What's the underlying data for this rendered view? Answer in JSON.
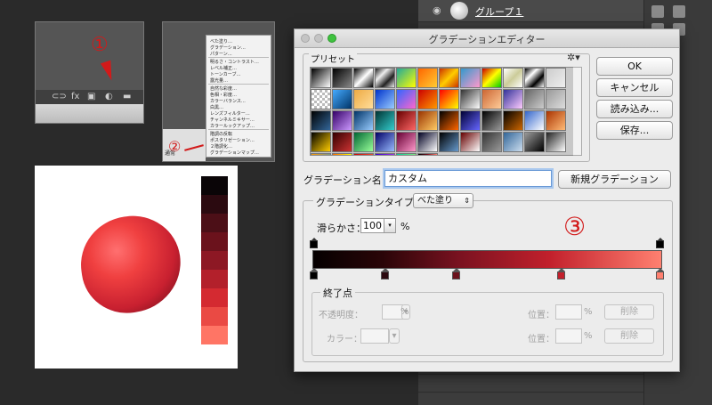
{
  "layers_panel": {
    "layer_name": "グループ１"
  },
  "annotations": {
    "circle1": "①",
    "circle2": "②",
    "circle3": "③"
  },
  "shot2_menu": {
    "items": [
      "べた塗り…",
      "グラデーション…",
      "パターン…",
      "明るさ・コントラスト…",
      "レベル補正…",
      "トーンカーブ…",
      "露光量…",
      "自然な彩度…",
      "色相・彩度…",
      "カラーバランス…",
      "白黒…",
      "レンズフィルター…",
      "チャンネルミキサー…",
      "カラールックアップ…",
      "階調の反転",
      "ポスタリゼーション…",
      "２階調化…",
      "グラデーションマップ…",
      "特定色域の選択…"
    ],
    "blend_label": "通常"
  },
  "dialog": {
    "title": "グラデーションエディター",
    "presets_label": "プリセット",
    "buttons": {
      "ok": "OK",
      "cancel": "キャンセル",
      "load": "読み込み...",
      "save": "保存..."
    },
    "name_label": "グラデーション名：",
    "name_value": "カスタム",
    "new_button": "新規グラデーション",
    "type_label": "グラデーションタイプ：",
    "type_value": "べた塗り",
    "smooth_label": "滑らかさ：",
    "smooth_value": "100",
    "percent": "%",
    "endpoint_label": "終了点",
    "opacity_label": "不透明度：",
    "color_label": "カラー：",
    "position_label": "位置：",
    "delete_label": "削除"
  },
  "colors": {
    "swatches": [
      "#0a0507",
      "#2b0a10",
      "#4c0f17",
      "#6b121c",
      "#8d1824",
      "#b3202b",
      "#d42a31",
      "#ea4a44",
      "#ff7565"
    ],
    "color_stops": [
      "#000000",
      "#2b0a10",
      "#6b121c",
      "#c2202c",
      "#ff8070"
    ]
  }
}
